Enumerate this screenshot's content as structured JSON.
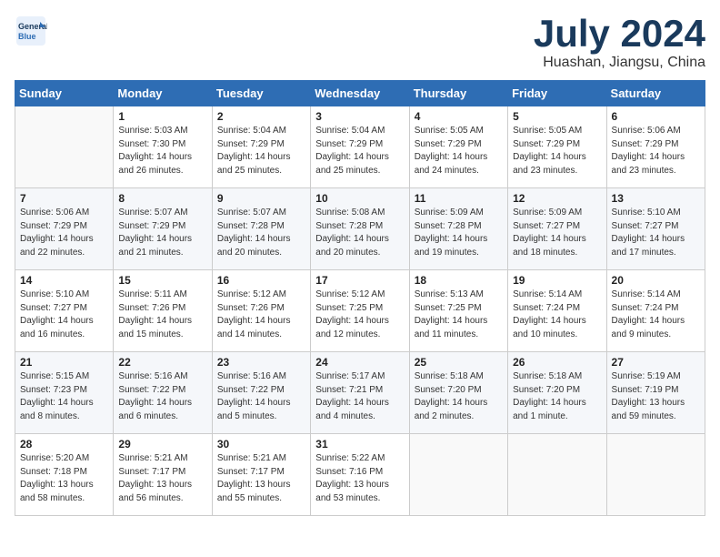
{
  "header": {
    "logo_line1": "General",
    "logo_line2": "Blue",
    "month_title": "July 2024",
    "location": "Huashan, Jiangsu, China"
  },
  "days_of_week": [
    "Sunday",
    "Monday",
    "Tuesday",
    "Wednesday",
    "Thursday",
    "Friday",
    "Saturday"
  ],
  "weeks": [
    [
      {
        "day": "",
        "info": ""
      },
      {
        "day": "1",
        "info": "Sunrise: 5:03 AM\nSunset: 7:30 PM\nDaylight: 14 hours\nand 26 minutes."
      },
      {
        "day": "2",
        "info": "Sunrise: 5:04 AM\nSunset: 7:29 PM\nDaylight: 14 hours\nand 25 minutes."
      },
      {
        "day": "3",
        "info": "Sunrise: 5:04 AM\nSunset: 7:29 PM\nDaylight: 14 hours\nand 25 minutes."
      },
      {
        "day": "4",
        "info": "Sunrise: 5:05 AM\nSunset: 7:29 PM\nDaylight: 14 hours\nand 24 minutes."
      },
      {
        "day": "5",
        "info": "Sunrise: 5:05 AM\nSunset: 7:29 PM\nDaylight: 14 hours\nand 23 minutes."
      },
      {
        "day": "6",
        "info": "Sunrise: 5:06 AM\nSunset: 7:29 PM\nDaylight: 14 hours\nand 23 minutes."
      }
    ],
    [
      {
        "day": "7",
        "info": "Sunrise: 5:06 AM\nSunset: 7:29 PM\nDaylight: 14 hours\nand 22 minutes."
      },
      {
        "day": "8",
        "info": "Sunrise: 5:07 AM\nSunset: 7:29 PM\nDaylight: 14 hours\nand 21 minutes."
      },
      {
        "day": "9",
        "info": "Sunrise: 5:07 AM\nSunset: 7:28 PM\nDaylight: 14 hours\nand 20 minutes."
      },
      {
        "day": "10",
        "info": "Sunrise: 5:08 AM\nSunset: 7:28 PM\nDaylight: 14 hours\nand 20 minutes."
      },
      {
        "day": "11",
        "info": "Sunrise: 5:09 AM\nSunset: 7:28 PM\nDaylight: 14 hours\nand 19 minutes."
      },
      {
        "day": "12",
        "info": "Sunrise: 5:09 AM\nSunset: 7:27 PM\nDaylight: 14 hours\nand 18 minutes."
      },
      {
        "day": "13",
        "info": "Sunrise: 5:10 AM\nSunset: 7:27 PM\nDaylight: 14 hours\nand 17 minutes."
      }
    ],
    [
      {
        "day": "14",
        "info": "Sunrise: 5:10 AM\nSunset: 7:27 PM\nDaylight: 14 hours\nand 16 minutes."
      },
      {
        "day": "15",
        "info": "Sunrise: 5:11 AM\nSunset: 7:26 PM\nDaylight: 14 hours\nand 15 minutes."
      },
      {
        "day": "16",
        "info": "Sunrise: 5:12 AM\nSunset: 7:26 PM\nDaylight: 14 hours\nand 14 minutes."
      },
      {
        "day": "17",
        "info": "Sunrise: 5:12 AM\nSunset: 7:25 PM\nDaylight: 14 hours\nand 12 minutes."
      },
      {
        "day": "18",
        "info": "Sunrise: 5:13 AM\nSunset: 7:25 PM\nDaylight: 14 hours\nand 11 minutes."
      },
      {
        "day": "19",
        "info": "Sunrise: 5:14 AM\nSunset: 7:24 PM\nDaylight: 14 hours\nand 10 minutes."
      },
      {
        "day": "20",
        "info": "Sunrise: 5:14 AM\nSunset: 7:24 PM\nDaylight: 14 hours\nand 9 minutes."
      }
    ],
    [
      {
        "day": "21",
        "info": "Sunrise: 5:15 AM\nSunset: 7:23 PM\nDaylight: 14 hours\nand 8 minutes."
      },
      {
        "day": "22",
        "info": "Sunrise: 5:16 AM\nSunset: 7:22 PM\nDaylight: 14 hours\nand 6 minutes."
      },
      {
        "day": "23",
        "info": "Sunrise: 5:16 AM\nSunset: 7:22 PM\nDaylight: 14 hours\nand 5 minutes."
      },
      {
        "day": "24",
        "info": "Sunrise: 5:17 AM\nSunset: 7:21 PM\nDaylight: 14 hours\nand 4 minutes."
      },
      {
        "day": "25",
        "info": "Sunrise: 5:18 AM\nSunset: 7:20 PM\nDaylight: 14 hours\nand 2 minutes."
      },
      {
        "day": "26",
        "info": "Sunrise: 5:18 AM\nSunset: 7:20 PM\nDaylight: 14 hours\nand 1 minute."
      },
      {
        "day": "27",
        "info": "Sunrise: 5:19 AM\nSunset: 7:19 PM\nDaylight: 13 hours\nand 59 minutes."
      }
    ],
    [
      {
        "day": "28",
        "info": "Sunrise: 5:20 AM\nSunset: 7:18 PM\nDaylight: 13 hours\nand 58 minutes."
      },
      {
        "day": "29",
        "info": "Sunrise: 5:21 AM\nSunset: 7:17 PM\nDaylight: 13 hours\nand 56 minutes."
      },
      {
        "day": "30",
        "info": "Sunrise: 5:21 AM\nSunset: 7:17 PM\nDaylight: 13 hours\nand 55 minutes."
      },
      {
        "day": "31",
        "info": "Sunrise: 5:22 AM\nSunset: 7:16 PM\nDaylight: 13 hours\nand 53 minutes."
      },
      {
        "day": "",
        "info": ""
      },
      {
        "day": "",
        "info": ""
      },
      {
        "day": "",
        "info": ""
      }
    ]
  ]
}
